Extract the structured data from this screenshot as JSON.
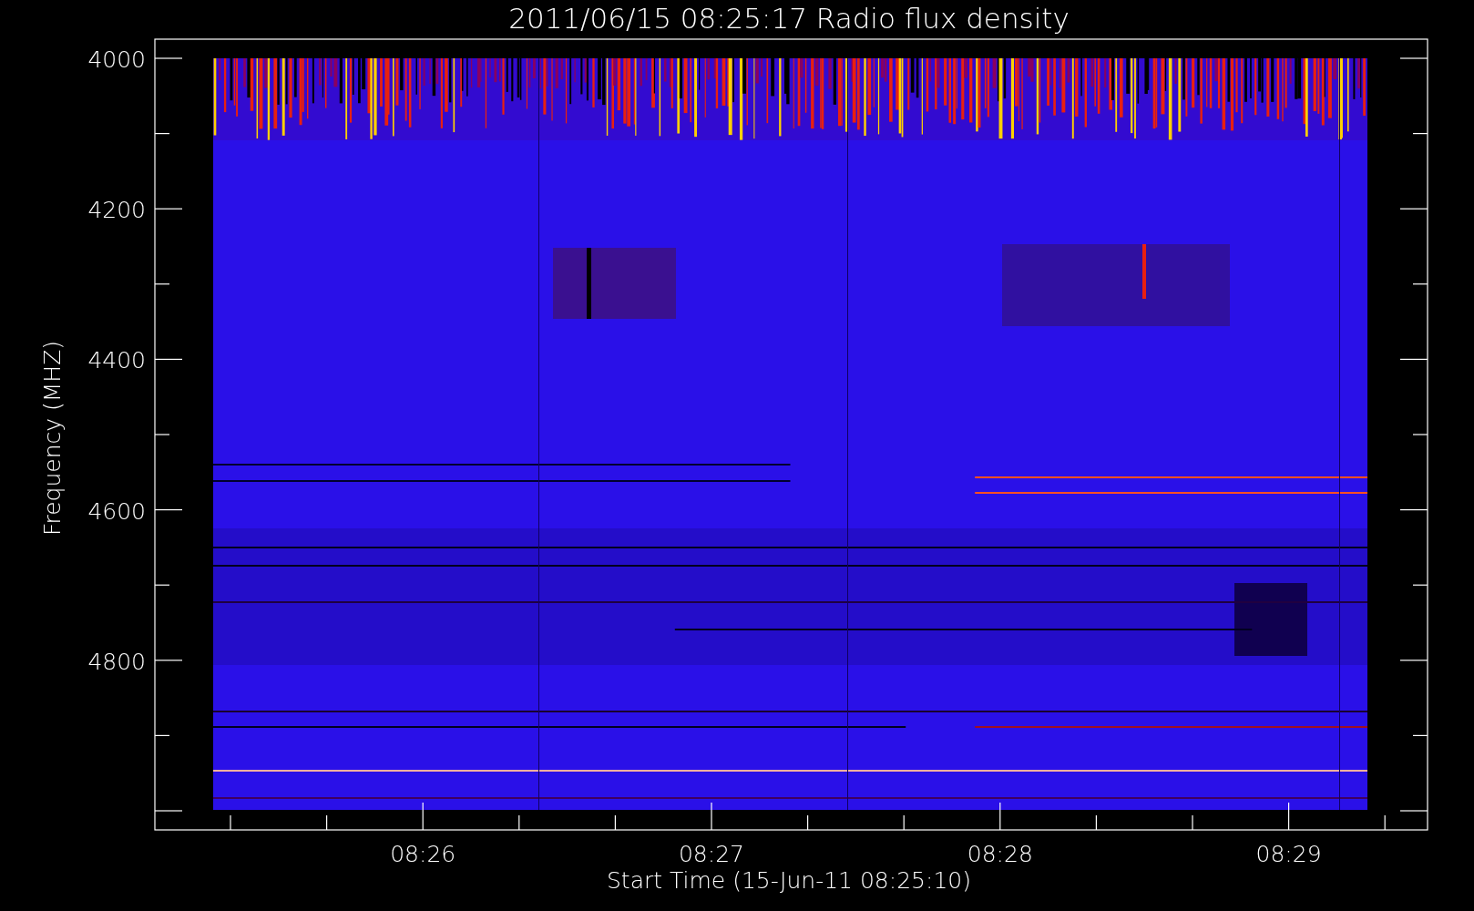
{
  "title": "2011/06/15 08:25:17 Radio flux density",
  "y_axis": {
    "label": "Frequency (MHZ)",
    "tick_labels": [
      "4000",
      "4200",
      "4400",
      "4600",
      "4800"
    ]
  },
  "x_axis": {
    "label": "Start Time (15-Jun-11 08:25:10)",
    "tick_labels": [
      "08:26",
      "08:27",
      "08:28",
      "08:29"
    ]
  }
}
